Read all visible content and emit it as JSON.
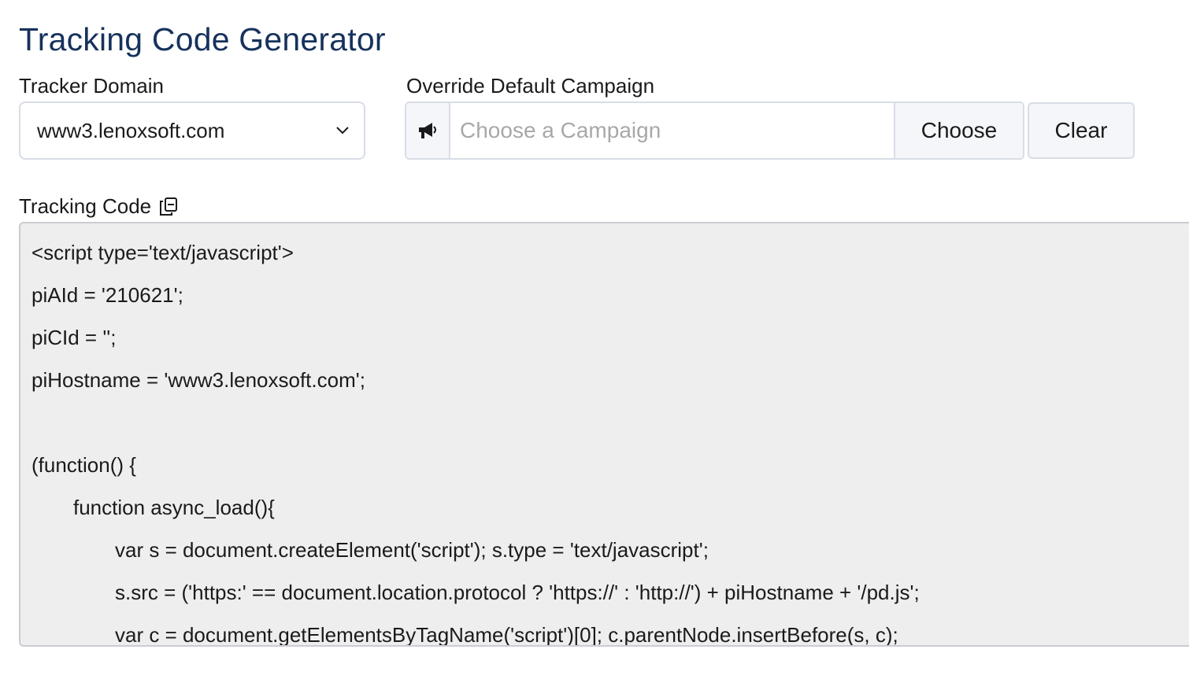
{
  "page": {
    "title": "Tracking Code Generator"
  },
  "tracker_domain": {
    "label": "Tracker Domain",
    "selected": "www3.lenoxsoft.com"
  },
  "campaign": {
    "label": "Override Default Campaign",
    "placeholder": "Choose a Campaign",
    "value": "",
    "icon": "megaphone-icon",
    "choose_label": "Choose",
    "clear_label": "Clear"
  },
  "tracking_code": {
    "label": "Tracking Code",
    "copy_icon": "copy-icon",
    "lines": [
      "<script type='text/javascript'>",
      "piAId = '210621';",
      "piCId = '';",
      "piHostname = 'www3.lenoxsoft.com';",
      "",
      "(function() {",
      "function async_load(){",
      "var s = document.createElement('script'); s.type = 'text/javascript';",
      "s.src = ('https:' == document.location.protocol ? 'https://' : 'http://') + piHostname + '/pd.js';",
      "var c = document.getElementsByTagName('script')[0]; c.parentNode.insertBefore(s, c);"
    ]
  },
  "colors": {
    "title": "#16325c",
    "border": "#d8dde6",
    "button_bg": "#f4f6f9",
    "code_bg": "#eeeeee"
  }
}
